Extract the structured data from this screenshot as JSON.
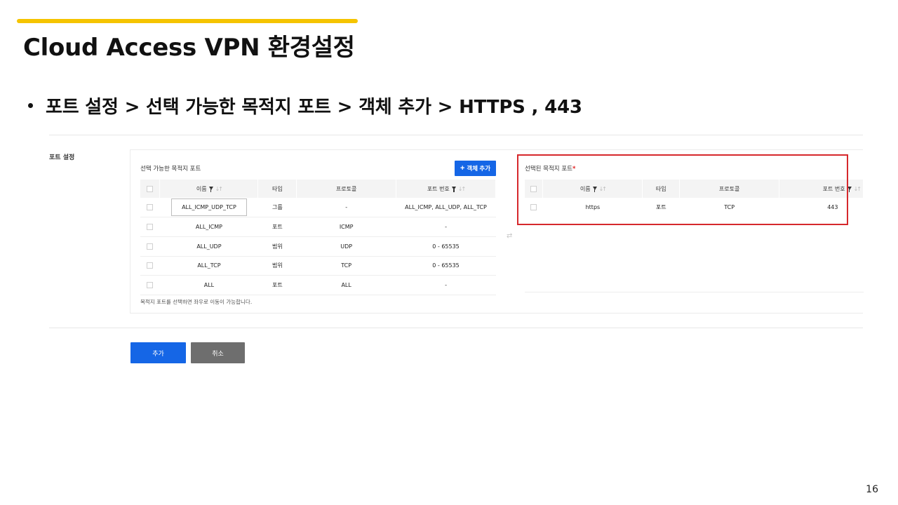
{
  "slide": {
    "title": "Cloud Access VPN 환경설정",
    "bullet": "포트 설정 > 선택 가능한 목적지 포트 > 객체 추가 > HTTPS , 443",
    "page_number": "16",
    "accent_color": "#f5c400"
  },
  "form": {
    "section_label": "포트 설정",
    "available": {
      "title": "선택 가능한 목적지 포트",
      "add_button_label": "객체 추가",
      "columns": [
        "이름",
        "타입",
        "프로토콜",
        "포트 번호"
      ],
      "rows": [
        {
          "name": "ALL_ICMP_UDP_TCP",
          "type": "그룹",
          "protocol": "-",
          "port": "ALL_ICMP, ALL_UDP, ALL_TCP"
        },
        {
          "name": "ALL_ICMP",
          "type": "포트",
          "protocol": "ICMP",
          "port": "-"
        },
        {
          "name": "ALL_UDP",
          "type": "범위",
          "protocol": "UDP",
          "port": "0 - 65535"
        },
        {
          "name": "ALL_TCP",
          "type": "범위",
          "protocol": "TCP",
          "port": "0 - 65535"
        },
        {
          "name": "ALL",
          "type": "포트",
          "protocol": "ALL",
          "port": "-"
        }
      ],
      "helper_text": "목적지 포트를 선택하면 좌우로 이동이 가능합니다."
    },
    "selected": {
      "title": "선택된 목적지 포트",
      "required_mark": "*",
      "columns": [
        "이름",
        "타입",
        "프로토콜",
        "포트 번호"
      ],
      "rows": [
        {
          "name": "https",
          "type": "포트",
          "protocol": "TCP",
          "port": "443"
        }
      ]
    },
    "buttons": {
      "add_label": "추가",
      "cancel_label": "취소"
    },
    "colors": {
      "primary_button": "#1566e6",
      "cancel_button": "#6e6e6e",
      "highlight": "#d6282c"
    }
  }
}
